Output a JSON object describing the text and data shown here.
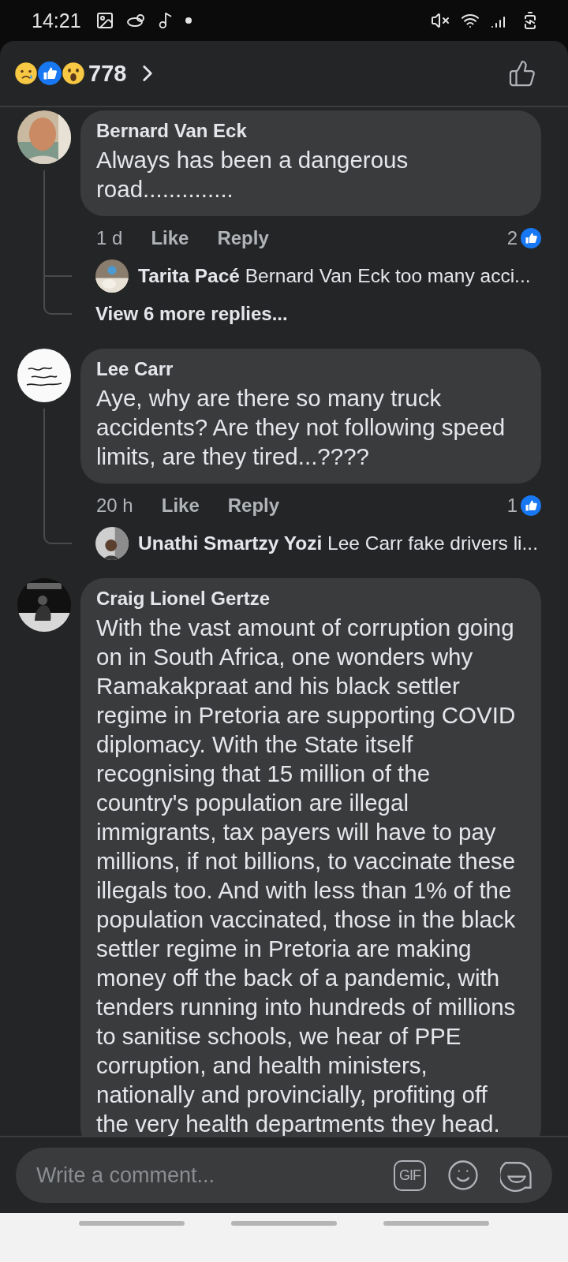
{
  "status_bar": {
    "time": "14:21"
  },
  "header": {
    "reactions_count": "778"
  },
  "comments": [
    {
      "author": "Bernard Van Eck",
      "text": "Always has been a dangerous road..............",
      "time": "1 d",
      "like": "Like",
      "reply": "Reply",
      "likes": "2",
      "thread": [
        {
          "kind": "reply",
          "author": "Tarita Pacé",
          "text": "Bernard Van Eck too many acci..."
        },
        {
          "kind": "more",
          "text": "View 6 more replies..."
        }
      ]
    },
    {
      "author": "Lee Carr",
      "text": "Aye, why are there so many truck accidents? Are they not following speed limits, are they tired...????",
      "time": "20 h",
      "like": "Like",
      "reply": "Reply",
      "likes": "1",
      "thread": [
        {
          "kind": "reply",
          "author": "Unathi Smartzy Yozi",
          "text": "Lee Carr fake drivers li..."
        }
      ]
    },
    {
      "author": "Craig Lionel Gertze",
      "text": "With the vast amount of corruption going on in South Africa, one wonders why Ramakakpraat and his black settler regime in Pretoria are supporting COVID diplomacy. With the State itself recognising that 15 million of the country's population are illegal immigrants, tax payers will have to pay millions, if not billions, to vaccinate these illegals too. And with less than 1% of the population vaccinated, those in the black settler regime in Pretoria are making money off the back of a pandemic, with tenders running into hundreds of millions to sanitise schools, we hear of PPE corruption, and health ministers, nationally and provincially, profiting off the very health departments they head."
    }
  ],
  "composer": {
    "placeholder": "Write a comment...",
    "gif": "GIF"
  }
}
